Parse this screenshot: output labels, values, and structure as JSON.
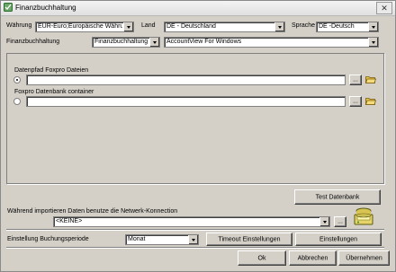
{
  "window": {
    "title": "Finanzbuchhaltung",
    "close_label": "✕"
  },
  "row1": {
    "waehrung_label": "Währung",
    "waehrung_value": "EUR-Euro;Europäische Währung",
    "land_label": "Land",
    "land_value": "DE - Deutschland",
    "sprache_label": "Sprache",
    "sprache_value": "DE -Deutsch"
  },
  "row2": {
    "fibu_label": "Finanzbuchhaltung",
    "fibu_value": "Finanzbuchhaltung",
    "system_value": "AccountView For Windows"
  },
  "datapath": {
    "foxpro_label": "Datenpfad  Foxpro Dateien",
    "container_label": "Foxpro Datenbank container",
    "foxpro_value": "",
    "container_value": "",
    "browse_label": "..."
  },
  "test_button": "Test Datenbank",
  "network": {
    "label": "Während importieren Daten benutze die Netwerk-Konnection",
    "value": "<KEINE>",
    "browse_label": "..."
  },
  "period": {
    "label": "Einstellung Buchungsperiode",
    "value": "Monat"
  },
  "buttons": {
    "timeout": "Timeout Einstellungen",
    "settings": "Einstellungen",
    "ok": "Ok",
    "cancel": "Abbrechen",
    "apply": "Übernehmen"
  }
}
